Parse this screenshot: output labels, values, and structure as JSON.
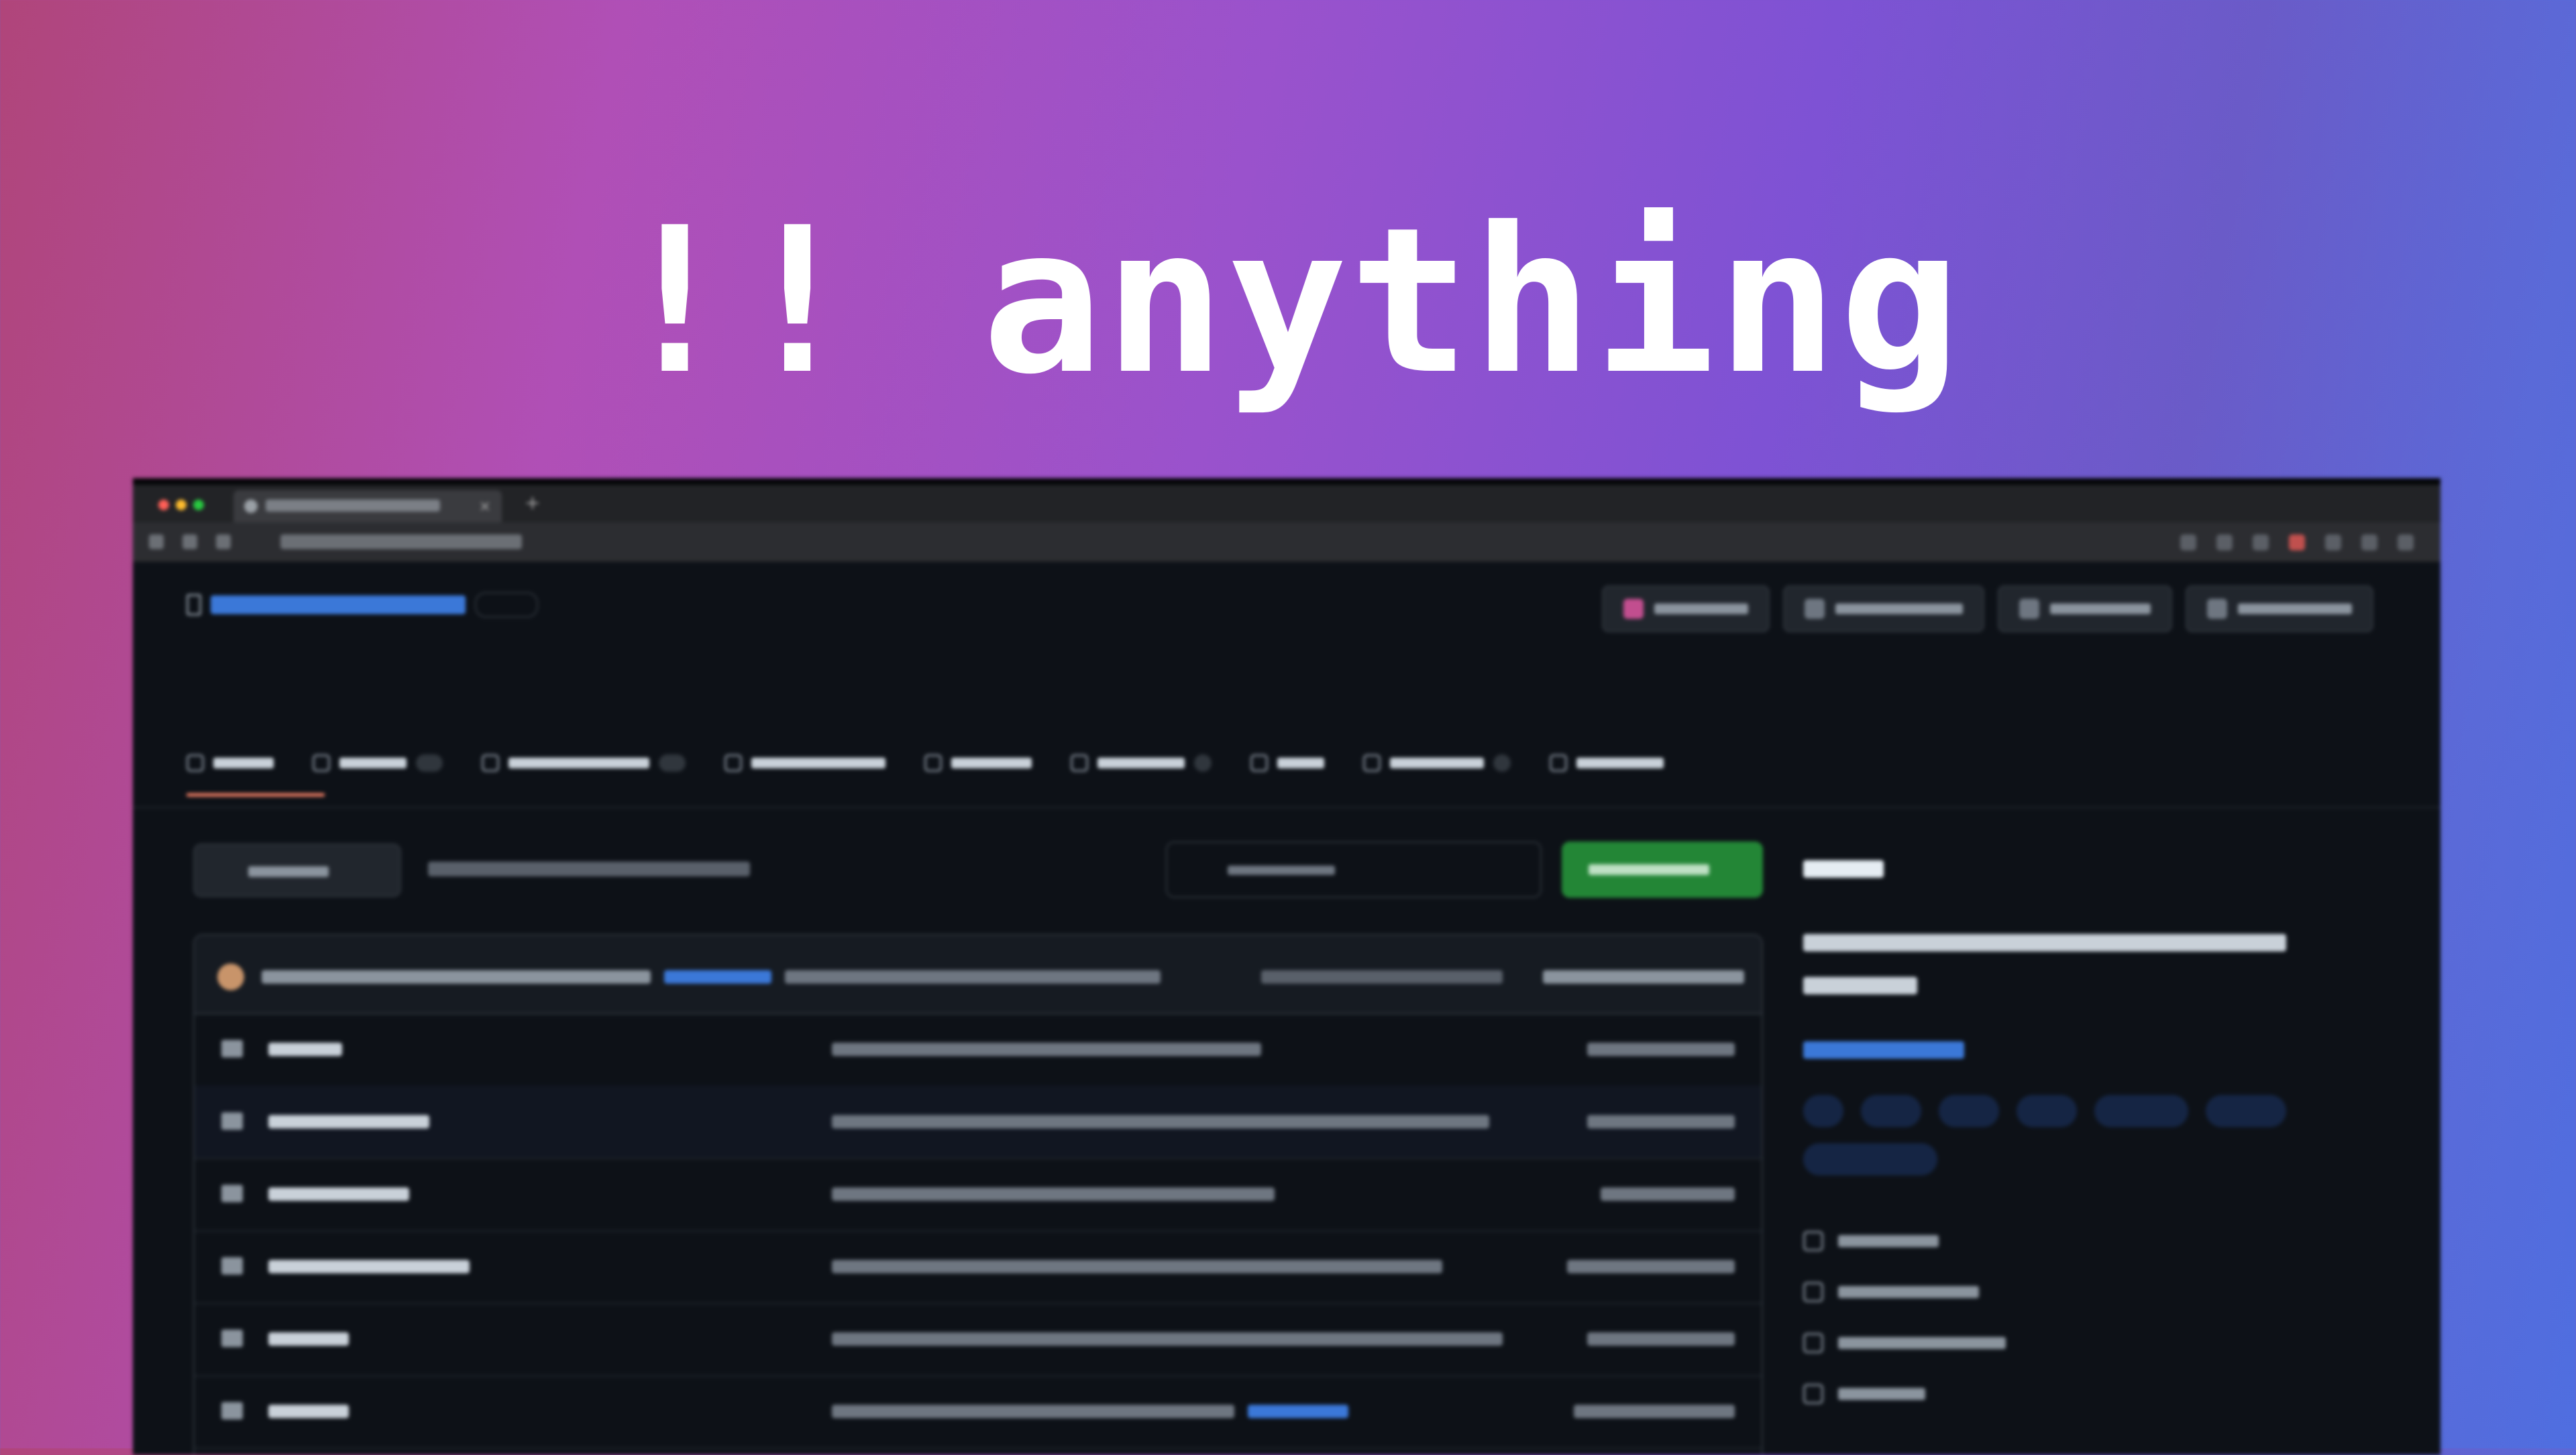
{
  "headline": "!! anything",
  "colors": {
    "background_gradient": [
      "#b0457a",
      "#9a52cc",
      "#4f6ee0"
    ],
    "headline": "#ffffff",
    "page_bg": "#0d1117",
    "accent_green": "#238636",
    "link_blue": "#3b78d8",
    "nav_underline": "#f78166"
  },
  "browser": {
    "traffic_light_colors": [
      "#ff5f57",
      "#febc2e",
      "#28c840"
    ],
    "tab_close_glyph": "×",
    "new_tab_glyph": "+"
  },
  "icons": {
    "repo": "book-icon",
    "nav": [
      "code-icon",
      "issues-icon",
      "pull-requests-icon",
      "discussions-icon",
      "actions-icon",
      "projects-icon",
      "wiki-icon",
      "security-icon",
      "insights-icon"
    ],
    "sidebar": [
      "readme-icon",
      "license-icon",
      "security-policy-icon",
      "activity-icon"
    ],
    "file_row": "folder-icon"
  },
  "file_rows": 6,
  "topics_count": 7
}
